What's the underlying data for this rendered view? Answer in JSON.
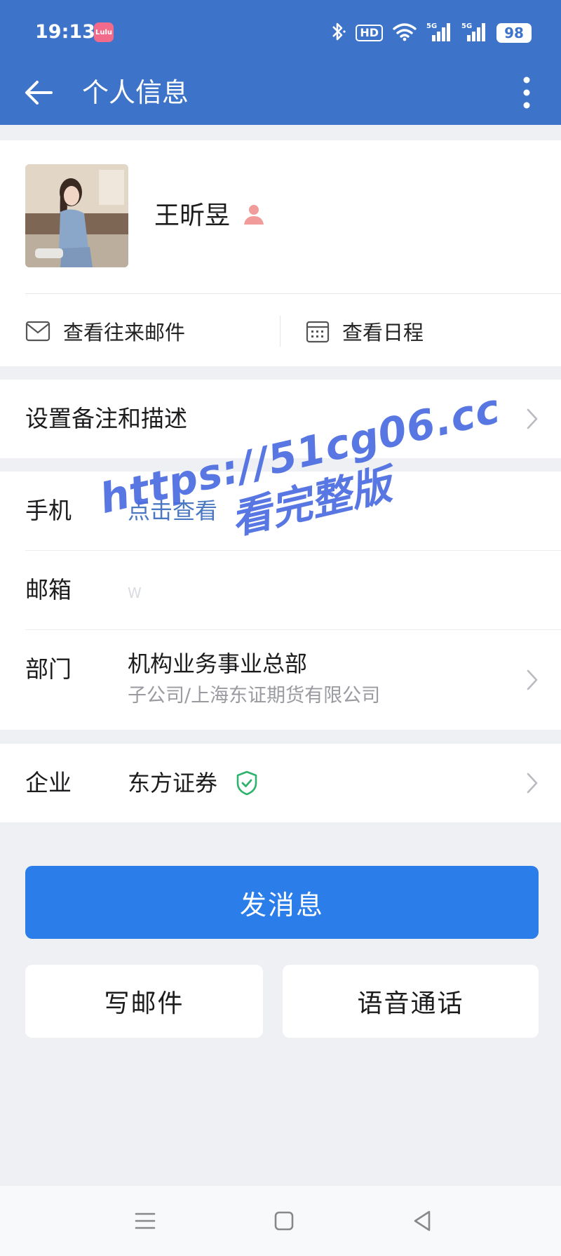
{
  "status_bar": {
    "time": "19:13",
    "app_badge": "Lulu",
    "hd_label": "HD",
    "battery": "98",
    "icons": [
      "bluetooth-icon",
      "wifi-icon",
      "signal-5g-icon",
      "signal-5g-icon"
    ]
  },
  "header": {
    "title": "个人信息",
    "back_icon": "back-arrow-icon",
    "more_icon": "more-vertical-icon"
  },
  "profile": {
    "name": "王昕昱",
    "avatar": "profile-photo",
    "actions": [
      {
        "label": "查看往来邮件",
        "icon": "mail-icon"
      },
      {
        "label": "查看日程",
        "icon": "calendar-icon"
      }
    ]
  },
  "remark": {
    "label": "设置备注和描述"
  },
  "info": {
    "phone": {
      "label": "手机",
      "value": "点击查看"
    },
    "email": {
      "label": "邮箱",
      "value": "W"
    },
    "department": {
      "label": "部门",
      "value": "机构业务事业总部",
      "sub": "子公司/上海东证期货有限公司"
    }
  },
  "company": {
    "label": "企业",
    "value": "东方证券",
    "verified_icon": "verified-shield-icon"
  },
  "buttons": {
    "send_message": "发消息",
    "write_mail": "写邮件",
    "voice_call": "语音通话"
  },
  "watermark": {
    "line1": "https://51cg06.cc",
    "line2": "看完整版"
  },
  "colors": {
    "header": "#3d73c9",
    "primary_button": "#2b7de9",
    "verified": "#2fb36c",
    "link": "#4a78c2"
  }
}
